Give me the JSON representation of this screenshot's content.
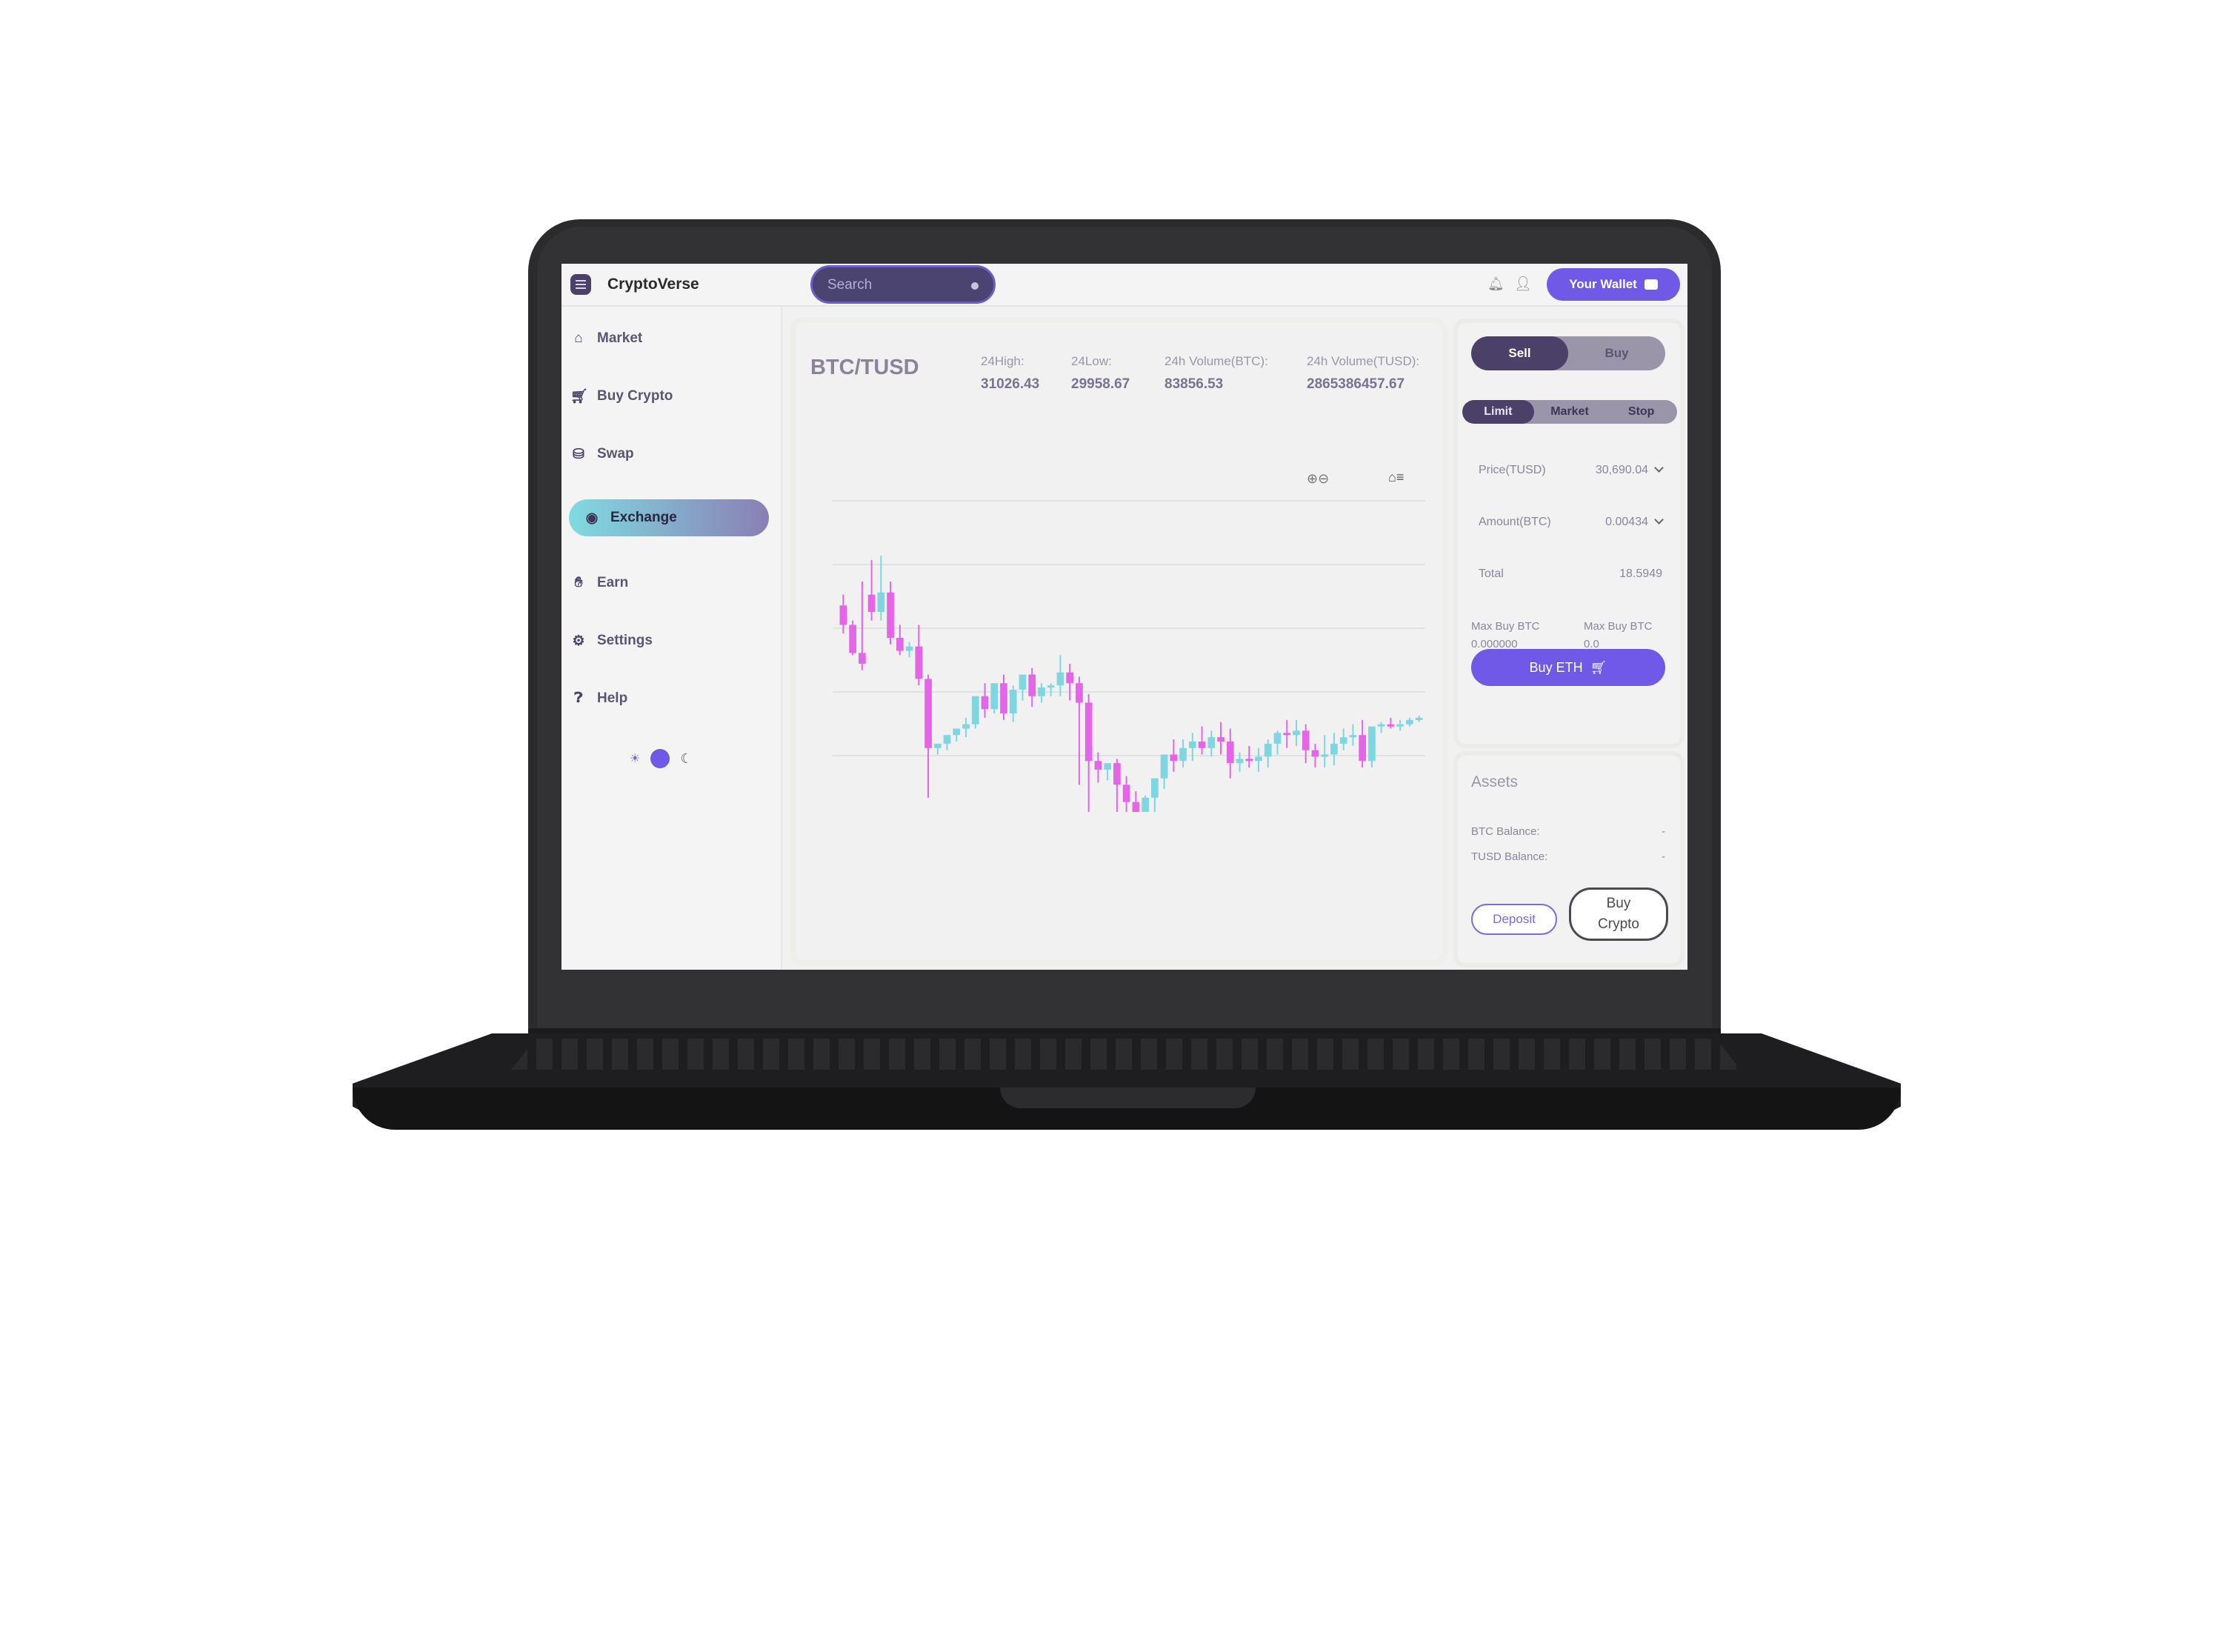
{
  "header": {
    "brand": "CryptoVerse",
    "search_placeholder": "Search",
    "wallet_label": "Your Wallet"
  },
  "sidebar": {
    "items": [
      {
        "label": "Market",
        "icon": "home-icon"
      },
      {
        "label": "Buy Crypto",
        "icon": "cart-icon"
      },
      {
        "label": "Swap",
        "icon": "coins-icon"
      },
      {
        "label": "Exchange",
        "icon": "exchange-icon",
        "active": true
      },
      {
        "label": "Earn",
        "icon": "hand-coin-icon"
      },
      {
        "label": "Settings",
        "icon": "gear-icon"
      },
      {
        "label": "Help",
        "icon": "help-icon"
      }
    ],
    "theme": "light"
  },
  "market": {
    "pair": "BTC/TUSD",
    "stats": [
      {
        "label": "24High:",
        "value": "31026.43"
      },
      {
        "label": "24Low:",
        "value": "29958.67"
      },
      {
        "label": "24h Volume(BTC):",
        "value": "83856.53"
      },
      {
        "label": "24h Volume(TUSD):",
        "value": "2865386457.67"
      }
    ]
  },
  "chart_data": {
    "type": "candlestick",
    "colors": {
      "up": "#7fd6e0",
      "down": "#e266e6"
    },
    "ylim": [
      29900,
      31100
    ],
    "candles": [
      [
        30650,
        30700,
        30560,
        30520
      ],
      [
        30560,
        30580,
        30430,
        30420
      ],
      [
        30430,
        30760,
        30380,
        30350
      ],
      [
        30700,
        30860,
        30620,
        30580
      ],
      [
        30620,
        30880,
        30710,
        30580
      ],
      [
        30710,
        30760,
        30500,
        30470
      ],
      [
        30500,
        30560,
        30440,
        30420
      ],
      [
        30440,
        30480,
        30460,
        30410
      ],
      [
        30460,
        30560,
        30310,
        30280
      ],
      [
        30310,
        30330,
        29990,
        29760
      ],
      [
        29990,
        30010,
        30010,
        29960
      ],
      [
        30010,
        30020,
        30050,
        29980
      ],
      [
        30050,
        30080,
        30080,
        30020
      ],
      [
        30080,
        30130,
        30100,
        30040
      ],
      [
        30100,
        30200,
        30230,
        30080
      ],
      [
        30230,
        30290,
        30170,
        30130
      ],
      [
        30170,
        30260,
        30290,
        30150
      ],
      [
        30290,
        30330,
        30150,
        30120
      ],
      [
        30150,
        30280,
        30260,
        30110
      ],
      [
        30260,
        30310,
        30330,
        30210
      ],
      [
        30330,
        30360,
        30230,
        30180
      ],
      [
        30230,
        30290,
        30270,
        30200
      ],
      [
        30270,
        30290,
        30280,
        30230
      ],
      [
        30280,
        30420,
        30340,
        30230
      ],
      [
        30340,
        30380,
        30290,
        30210
      ],
      [
        30290,
        30320,
        30200,
        29820
      ],
      [
        30200,
        30240,
        29930,
        29590
      ],
      [
        29930,
        29970,
        29890,
        29830
      ],
      [
        29890,
        29920,
        29920,
        29840
      ],
      [
        29920,
        29940,
        29820,
        29600
      ],
      [
        29820,
        29860,
        29740,
        29560
      ],
      [
        29740,
        29790,
        29680,
        29560
      ],
      [
        29680,
        29770,
        29760,
        29610
      ],
      [
        29760,
        29830,
        29850,
        29680
      ],
      [
        29850,
        29900,
        29960,
        29800
      ],
      [
        29960,
        30030,
        29930,
        29880
      ],
      [
        29930,
        30030,
        29990,
        29900
      ],
      [
        29990,
        30060,
        30020,
        29930
      ],
      [
        30020,
        30090,
        29990,
        29960
      ],
      [
        29990,
        30070,
        30040,
        29950
      ],
      [
        30040,
        30110,
        30020,
        29960
      ],
      [
        30020,
        30080,
        29920,
        29850
      ],
      [
        29920,
        29970,
        29940,
        29880
      ],
      [
        29940,
        30000,
        29930,
        29900
      ],
      [
        29930,
        29990,
        29950,
        29880
      ],
      [
        29950,
        30030,
        30010,
        29900
      ],
      [
        30010,
        30070,
        30060,
        29960
      ],
      [
        30060,
        30120,
        30050,
        29990
      ],
      [
        30050,
        30120,
        30070,
        30000
      ],
      [
        30070,
        30100,
        29980,
        29920
      ],
      [
        29980,
        30010,
        29950,
        29900
      ],
      [
        29950,
        30050,
        29960,
        29900
      ],
      [
        29960,
        30060,
        30010,
        29910
      ],
      [
        30010,
        30080,
        30040,
        29980
      ],
      [
        30040,
        30100,
        30050,
        30000
      ],
      [
        30050,
        30120,
        29930,
        29900
      ],
      [
        29930,
        30080,
        30090,
        29900
      ],
      [
        30090,
        30110,
        30100,
        30060
      ],
      [
        30100,
        30130,
        30090,
        30080
      ],
      [
        30090,
        30120,
        30100,
        30070
      ],
      [
        30100,
        30130,
        30120,
        30090
      ],
      [
        30120,
        30140,
        30130,
        30110
      ]
    ]
  },
  "order_form": {
    "sides": [
      "Sell",
      "Buy"
    ],
    "active_side": "Sell",
    "types": [
      "Limit",
      "Market",
      "Stop"
    ],
    "active_type": "Limit",
    "price_label": "Price(TUSD)",
    "price_value": "30,690.04",
    "amount_label": "Amount(BTC)",
    "amount_value": "0.00434",
    "total_label": "Total",
    "total_value": "18.5949",
    "max_left_label": "Max Buy BTC",
    "max_left_value": "0.000000",
    "max_right_label": "Max Buy BTC",
    "max_right_value": "0.0",
    "submit_label": "Buy ETH"
  },
  "assets": {
    "title": "Assets",
    "rows": [
      {
        "label": "BTC Balance:",
        "value": "-"
      },
      {
        "label": "TUSD Balance:",
        "value": "-"
      }
    ],
    "deposit_label": "Deposit",
    "buy_crypto_label": "Buy Crypto"
  }
}
